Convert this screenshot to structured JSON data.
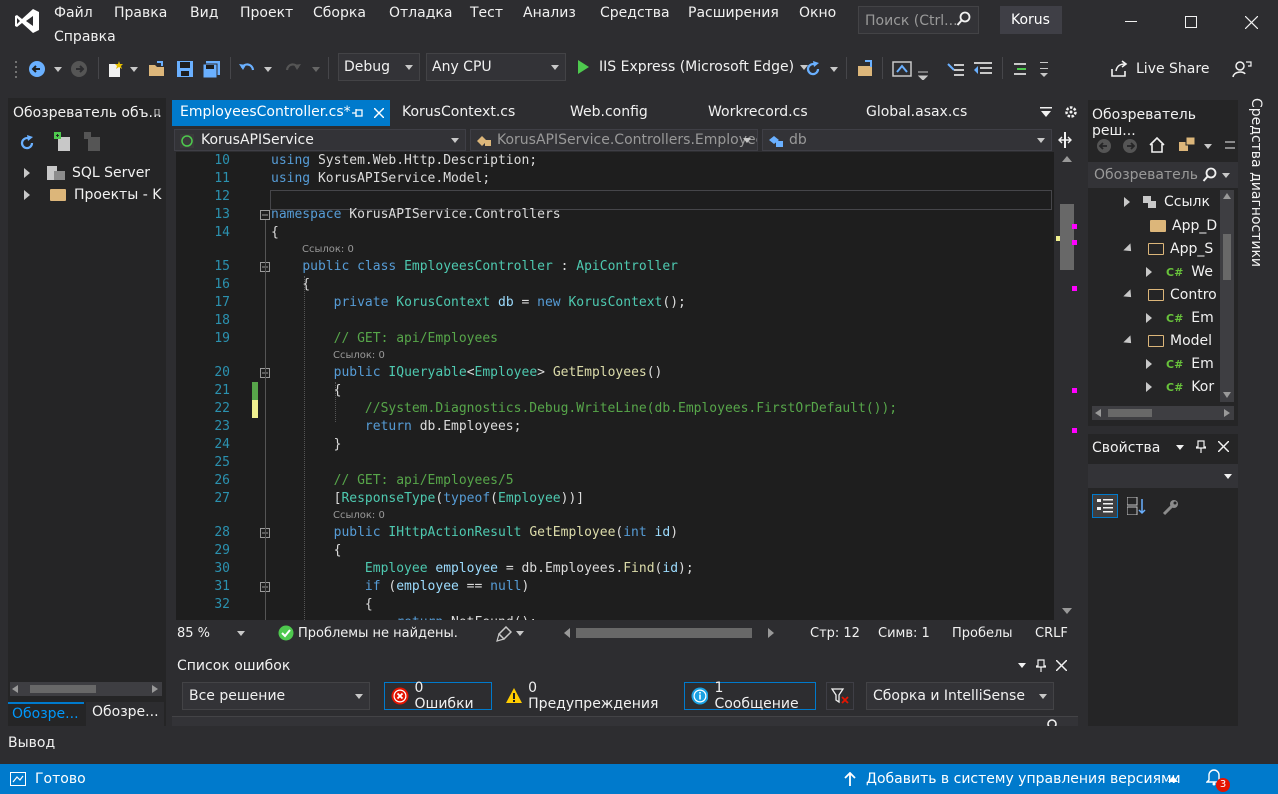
{
  "menubar": {
    "items": [
      "Файл",
      "Правка",
      "Вид",
      "Проект",
      "Сборка",
      "Отладка",
      "Тест",
      "Анализ",
      "Средства",
      "Расширения",
      "Окно",
      "Справка"
    ],
    "search_placeholder": "Поиск (Ctrl...",
    "profile": "Korus"
  },
  "toolbar": {
    "config": "Debug",
    "platform": "Any CPU",
    "run_label": "IIS Express (Microsoft Edge)",
    "live_share": "Live Share"
  },
  "left_panel": {
    "title": "Обозреватель объ...",
    "items": [
      "SQL Server",
      "Проекты - K"
    ],
    "tabs": [
      "Обозре...",
      "Обозре..."
    ]
  },
  "editor": {
    "tabs": [
      {
        "label": "EmployeesController.cs*",
        "active": true
      },
      {
        "label": "KorusContext.cs",
        "active": false
      },
      {
        "label": "Web.config",
        "active": false
      },
      {
        "label": "Workrecord.cs",
        "active": false
      },
      {
        "label": "Global.asax.cs",
        "active": false
      }
    ],
    "nav": {
      "project": "KorusAPIService",
      "class": "KorusAPIService.Controllers.Employee",
      "member": "db"
    },
    "refs_label": "Ссылок: 0",
    "line_numbers": [
      "10",
      "11",
      "12",
      "13",
      "14",
      "15",
      "16",
      "17",
      "18",
      "19",
      "20",
      "21",
      "22",
      "23",
      "24",
      "25",
      "26",
      "27",
      "28",
      "29",
      "30",
      "31",
      "32"
    ],
    "status": {
      "zoom": "85 %",
      "problems": "Проблемы не найдены.",
      "line": "Стр: 12",
      "col": "Симв: 1",
      "spaces": "Пробелы",
      "eol": "CRLF"
    }
  },
  "error_list": {
    "title": "Список ошибок",
    "scope": "Все решение",
    "errors": "0 Ошибки",
    "warnings": "0 Предупреждения",
    "messages": "1 Сообщение",
    "build": "Сборка и IntelliSense"
  },
  "solution_explorer": {
    "title": "Обозреватель реш...",
    "search_placeholder": "Обозреватель",
    "items": [
      "Ссылк",
      "App_D",
      "App_S",
      "We",
      "Contro",
      "Em",
      "Model",
      "Em",
      "Kor"
    ]
  },
  "properties": {
    "title": "Свойства"
  },
  "diag_tab": "Средства диагностики",
  "output": {
    "title": "Вывод"
  },
  "status": {
    "ready": "Готово",
    "vcs": "Добавить в систему управления версиями",
    "notifications": "3"
  }
}
